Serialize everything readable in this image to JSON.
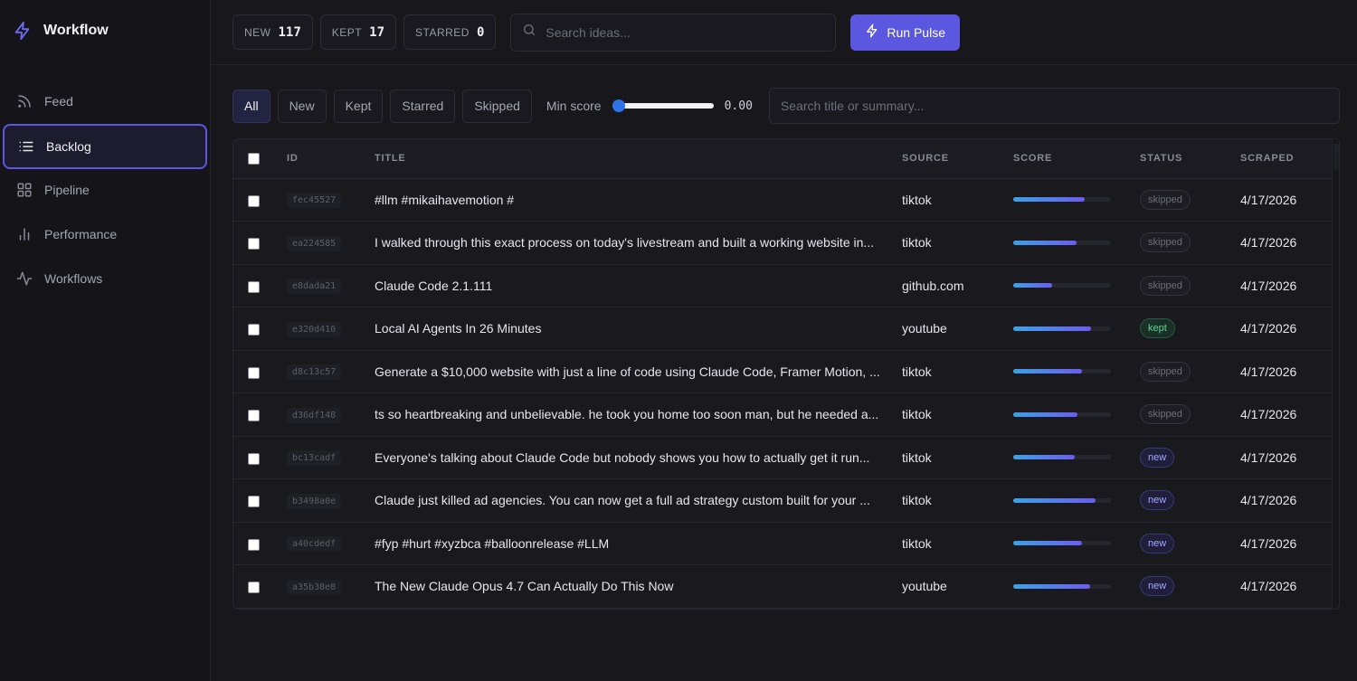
{
  "app": {
    "title": "Workflow"
  },
  "sidebar": {
    "items": [
      {
        "label": "Feed",
        "icon": "rss-icon"
      },
      {
        "label": "Backlog",
        "icon": "list-icon",
        "active": true
      },
      {
        "label": "Pipeline",
        "icon": "grid-icon"
      },
      {
        "label": "Performance",
        "icon": "bar-chart-icon"
      },
      {
        "label": "Workflows",
        "icon": "activity-icon"
      }
    ]
  },
  "topbar": {
    "stats": [
      {
        "label": "NEW",
        "value": "117"
      },
      {
        "label": "KEPT",
        "value": "17"
      },
      {
        "label": "STARRED",
        "value": "0"
      }
    ],
    "search_placeholder": "Search ideas...",
    "run_label": "Run Pulse"
  },
  "filters": {
    "chips": [
      "All",
      "New",
      "Kept",
      "Starred",
      "Skipped"
    ],
    "active_chip": "All",
    "min_score_label": "Min score",
    "min_score_value": "0.00",
    "min_score_fraction": 0,
    "search_placeholder": "Search title or summary..."
  },
  "table": {
    "columns": [
      "ID",
      "TITLE",
      "SOURCE",
      "SCORE",
      "STATUS",
      "SCRAPED"
    ],
    "rows": [
      {
        "id": "fec45527",
        "title": "#llm #mikaihavemotion #",
        "source": "tiktok",
        "score": 0.73,
        "status": "skipped",
        "scraped": "4/17/2026"
      },
      {
        "id": "ea224585",
        "title": "I walked through this exact process on today's livestream and built a working website in...",
        "source": "tiktok",
        "score": 0.65,
        "status": "skipped",
        "scraped": "4/17/2026"
      },
      {
        "id": "e8dada21",
        "title": "Claude Code 2.1.111",
        "source": "github.com",
        "score": 0.4,
        "status": "skipped",
        "scraped": "4/17/2026"
      },
      {
        "id": "e320d410",
        "title": "Local AI Agents In 26 Minutes",
        "source": "youtube",
        "score": 0.8,
        "status": "kept",
        "scraped": "4/17/2026"
      },
      {
        "id": "d8c13c57",
        "title": "Generate a $10,000 website with just a line of code using Claude Code, Framer Motion, ...",
        "source": "tiktok",
        "score": 0.7,
        "status": "skipped",
        "scraped": "4/17/2026"
      },
      {
        "id": "d36df148",
        "title": "ts so heartbreaking and unbelievable. he took you home too soon man, but he needed a...",
        "source": "tiktok",
        "score": 0.66,
        "status": "skipped",
        "scraped": "4/17/2026"
      },
      {
        "id": "bc13cadf",
        "title": "Everyone's talking about Claude Code but nobody shows you how to actually get it run...",
        "source": "tiktok",
        "score": 0.63,
        "status": "new",
        "scraped": "4/17/2026"
      },
      {
        "id": "b3498a0e",
        "title": "Claude just killed ad agencies. You can now get a full ad strategy custom built for your ...",
        "source": "tiktok",
        "score": 0.84,
        "status": "new",
        "scraped": "4/17/2026"
      },
      {
        "id": "a40cdedf",
        "title": "#fyp #hurt #xyzbca #balloonrelease #LLM",
        "source": "tiktok",
        "score": 0.7,
        "status": "new",
        "scraped": "4/17/2026"
      },
      {
        "id": "a35b38e8",
        "title": "The New Claude Opus 4.7 Can Actually Do This Now",
        "source": "youtube",
        "score": 0.79,
        "status": "new",
        "scraped": "4/17/2026"
      }
    ]
  },
  "colors": {
    "accent": "#5b57e0",
    "kept": "#5fd39a",
    "new": "#a8a6ff",
    "skipped": "#6e6e7a"
  }
}
